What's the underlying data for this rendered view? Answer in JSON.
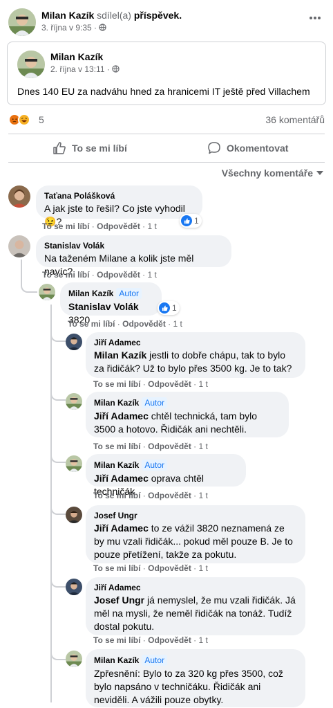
{
  "post": {
    "author": "Milan Kazík",
    "verb": "sdílel(a)",
    "object": "příspěvek.",
    "time": "3. října v 9:35 ·",
    "privacy_icon": "globe-icon"
  },
  "shared_post": {
    "author": "Milan Kazík",
    "time": "2. října v 13:11 ·",
    "privacy_icon": "globe-icon",
    "text": "Dnes 140 EU za nadváhu hned za hranicemi IT ještě před Villachem"
  },
  "stats": {
    "reactions": [
      "angry",
      "haha"
    ],
    "reaction_count": "5",
    "comment_count": "36 komentářů"
  },
  "actions": {
    "like": "To se mi líbí",
    "comment": "Okomentovat"
  },
  "sort_label": "Všechny komentáře",
  "comment_actions": {
    "like": "To se mi líbí",
    "reply": "Odpovědět",
    "age": "1 t"
  },
  "author_badge": "Autor",
  "comments": [
    {
      "author": "Taťana Polášková",
      "text": "A jak jste to řešil? Co jste vyhodil",
      "emoji": "😉",
      "text_end": "?",
      "likes": "1"
    },
    {
      "author": "Stanislav Volák",
      "text": "Na taženém Milane a kolik jste měl navíc?"
    },
    {
      "author": "Milan Kazík",
      "is_author": true,
      "mention": "Stanislav Volák",
      "text": "3820",
      "likes": "1"
    },
    {
      "author": "Jiří Adamec",
      "mention": "Milan Kazík",
      "text": "jestli to dobře chápu, tak to bylo za řidičák? Už to bylo přes 3500 kg. Je to tak?"
    },
    {
      "author": "Milan Kazík",
      "is_author": true,
      "mention": "Jiří Adamec",
      "text": "chtěl technická, tam bylo 3500 a hotovo. Řidičák ani nechtěli."
    },
    {
      "author": "Milan Kazík",
      "is_author": true,
      "mention": "Jiří Adamec",
      "text": "oprava chtěl techničák"
    },
    {
      "author": "Josef Ungr",
      "mention": "Jiří Adamec",
      "text": "to ze vážil 3820 neznamená ze by mu vzali řidičák... pokud měl pouze B. Je to pouze přetížení, takže za pokutu."
    },
    {
      "author": "Jiří Adamec",
      "mention": "Josef Ungr",
      "text": "já nemyslel, že mu vzali řidičák. Já měl na mysli, že neměl řidičák na tonáž. Tudíž dostal pokutu."
    },
    {
      "author": "Milan Kazík",
      "is_author": true,
      "text": "Zpřesnění: Bylo to za 320 kg přes 3500, což bylo napsáno v techničáku. Řidičák ani neviděli. A vážili pouze obytky."
    }
  ],
  "colors": {
    "link_blue": "#1877f2",
    "secondary_text": "#65676b",
    "bubble_bg": "#f0f2f5",
    "divider": "#ced0d4"
  }
}
